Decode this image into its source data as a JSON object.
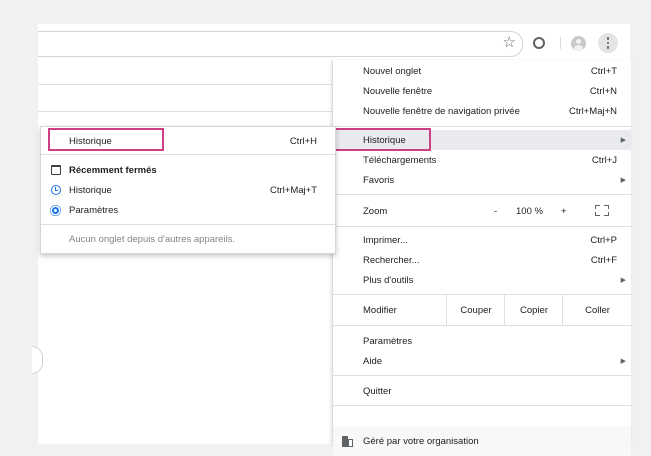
{
  "toolbar": {
    "bookmark_icon": "star-outline-icon",
    "extension_icon": "circle-extension-icon",
    "profile_icon": "profile-avatar-icon",
    "menu_icon": "vertical-ellipsis-icon"
  },
  "main_menu": {
    "new_tab": {
      "label": "Nouvel onglet",
      "shortcut": "Ctrl+T"
    },
    "new_window": {
      "label": "Nouvelle fenêtre",
      "shortcut": "Ctrl+N"
    },
    "incognito": {
      "label": "Nouvelle fenêtre de navigation privée",
      "shortcut": "Ctrl+Maj+N"
    },
    "history": {
      "label": "Historique"
    },
    "downloads": {
      "label": "Téléchargements",
      "shortcut": "Ctrl+J"
    },
    "favorites": {
      "label": "Favoris"
    },
    "zoom": {
      "label": "Zoom",
      "minus": "-",
      "value": "100 %",
      "plus": "+"
    },
    "print": {
      "label": "Imprimer...",
      "shortcut": "Ctrl+P"
    },
    "find": {
      "label": "Rechercher...",
      "shortcut": "Ctrl+F"
    },
    "more_tools": {
      "label": "Plus d'outils"
    },
    "edit": {
      "label": "Modifier",
      "cut": "Couper",
      "copy": "Copier",
      "paste": "Coller"
    },
    "settings": {
      "label": "Paramètres"
    },
    "help": {
      "label": "Aide"
    },
    "quit": {
      "label": "Quitter"
    },
    "managed": {
      "label": "Géré par votre organisation"
    }
  },
  "history_submenu": {
    "history": {
      "label": "Historique",
      "shortcut": "Ctrl+H"
    },
    "recently_closed": {
      "label": "Récemment fermés"
    },
    "history_entry": {
      "label": "Historique",
      "shortcut": "Ctrl+Maj+T"
    },
    "settings_entry": {
      "label": "Paramètres"
    },
    "no_tabs": {
      "label": "Aucun onglet depuis d'autres appareils."
    }
  },
  "colors": {
    "highlight": "#cf3f85",
    "hover": "#e8eaed",
    "accent": "#1a73e8"
  }
}
